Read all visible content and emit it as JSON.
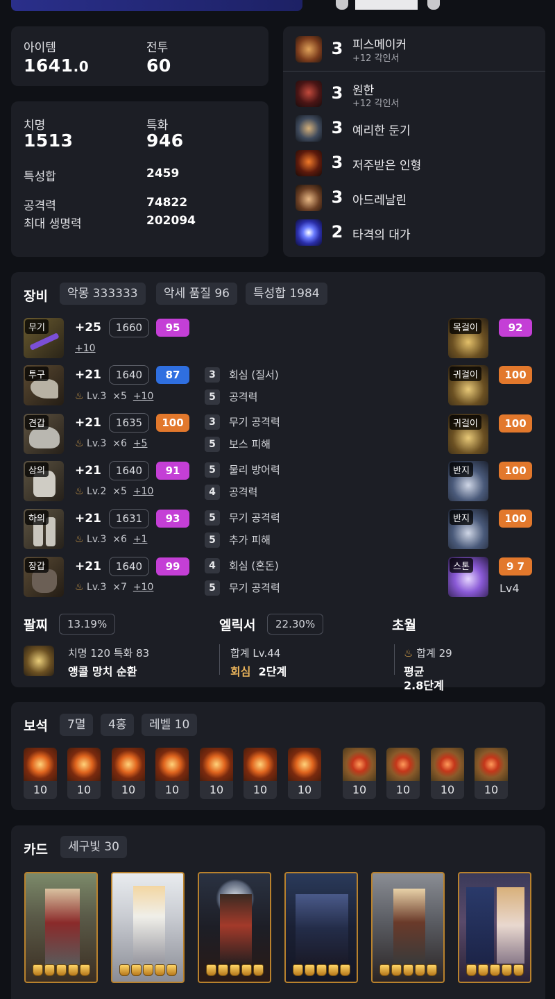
{
  "profile": {
    "item_label": "아이템",
    "item_value_main": "1641",
    "item_value_dec": ".0",
    "combat_label": "전투",
    "combat_value": "60"
  },
  "stats": {
    "crit_label": "치명",
    "crit_value": "1513",
    "spec_label": "특화",
    "spec_value": "946",
    "total_label": "특성합",
    "total_value": "2459",
    "atk_label": "공격력",
    "atk_value": "74822",
    "hp_label": "최대 생명력",
    "hp_value": "202094"
  },
  "engravings": [
    {
      "level": "3",
      "name": "피스메이커",
      "sub": "+12 각인서",
      "icon": "peacemaker-icon"
    },
    {
      "level": "3",
      "name": "원한",
      "sub": "+12 각인서",
      "icon": "grudge-icon"
    },
    {
      "level": "3",
      "name": "예리한 둔기",
      "sub": "",
      "icon": "keen-blunt-icon"
    },
    {
      "level": "3",
      "name": "저주받은 인형",
      "sub": "",
      "icon": "cursed-doll-icon"
    },
    {
      "level": "3",
      "name": "아드레날린",
      "sub": "",
      "icon": "adrenaline-icon"
    },
    {
      "level": "2",
      "name": "타격의 대가",
      "sub": "",
      "icon": "hit-master-icon"
    }
  ],
  "equipment": {
    "title": "장비",
    "chips": [
      "악몽 333333",
      "악세 품질 96",
      "특성합 1984"
    ],
    "flame_icon": "flame-icon",
    "left": [
      {
        "tag": "무기",
        "plus": "+25",
        "ilvl": "1660",
        "quality": "95",
        "qcolor": "purple",
        "lv": "",
        "x": "",
        "adv": "+10",
        "opts": []
      },
      {
        "tag": "투구",
        "plus": "+21",
        "ilvl": "1640",
        "quality": "87",
        "qcolor": "blue",
        "lv": "Lv.3",
        "x": "×5",
        "adv": "+10",
        "opts": [
          {
            "n": "3",
            "t": "회심 (질서)"
          },
          {
            "n": "5",
            "t": "공격력"
          }
        ]
      },
      {
        "tag": "견갑",
        "plus": "+21",
        "ilvl": "1635",
        "quality": "100",
        "qcolor": "orange",
        "lv": "Lv.3",
        "x": "×6",
        "adv": "+5",
        "opts": [
          {
            "n": "3",
            "t": "무기 공격력"
          },
          {
            "n": "5",
            "t": "보스 피해"
          }
        ]
      },
      {
        "tag": "상의",
        "plus": "+21",
        "ilvl": "1640",
        "quality": "91",
        "qcolor": "purple",
        "lv": "Lv.2",
        "x": "×5",
        "adv": "+10",
        "opts": [
          {
            "n": "5",
            "t": "물리 방어력"
          },
          {
            "n": "4",
            "t": "공격력"
          }
        ]
      },
      {
        "tag": "하의",
        "plus": "+21",
        "ilvl": "1631",
        "quality": "93",
        "qcolor": "purple",
        "lv": "Lv.3",
        "x": "×6",
        "adv": "+1",
        "opts": [
          {
            "n": "5",
            "t": "무기 공격력"
          },
          {
            "n": "5",
            "t": "추가 피해"
          }
        ]
      },
      {
        "tag": "장갑",
        "plus": "+21",
        "ilvl": "1640",
        "quality": "99",
        "qcolor": "purple",
        "lv": "Lv.3",
        "x": "×7",
        "adv": "+10",
        "opts": [
          {
            "n": "4",
            "t": "회심 (혼돈)"
          },
          {
            "n": "5",
            "t": "무기 공격력"
          }
        ]
      }
    ],
    "right": [
      {
        "tag": "목걸이",
        "quality": "92",
        "qcolor": "purple"
      },
      {
        "tag": "귀걸이",
        "quality": "100",
        "qcolor": "orange"
      },
      {
        "tag": "귀걸이",
        "quality": "100",
        "qcolor": "orange"
      },
      {
        "tag": "반지",
        "quality": "100",
        "qcolor": "orange"
      },
      {
        "tag": "반지",
        "quality": "100",
        "qcolor": "orange"
      },
      {
        "tag": "스톤",
        "quality": "9 7",
        "qcolor": "orange",
        "extra": "Lv4"
      }
    ]
  },
  "bracelet": {
    "title": "팔찌",
    "chip": "13.19%",
    "line1": "치명 120  특화 83",
    "line2": "앵콜  망치  순환"
  },
  "elixir": {
    "title": "엘릭서",
    "chip": "22.30%",
    "line1": "합계 Lv.44",
    "line2_accent": "회심",
    "line2_rest": "2단계"
  },
  "transcend": {
    "title": "초월",
    "line1": "합계 29",
    "line2": "평균",
    "line3": "2.8단계"
  },
  "gems": {
    "title": "보석",
    "chips": [
      "7멸",
      "4홍",
      "레벨 10"
    ],
    "items": [
      "10",
      "10",
      "10",
      "10",
      "10",
      "10",
      "10",
      "10",
      "10",
      "10",
      "10"
    ]
  },
  "cards": {
    "title": "카드",
    "chip": "세구빛 30",
    "items": [
      {
        "name": "card-1",
        "awaken": 5
      },
      {
        "name": "card-2",
        "awaken": 5
      },
      {
        "name": "card-3",
        "awaken": 5
      },
      {
        "name": "card-4",
        "awaken": 5
      },
      {
        "name": "card-5",
        "awaken": 5
      },
      {
        "name": "card-6",
        "awaken": 5
      }
    ]
  },
  "colors": {
    "purple": "#c43fd6",
    "blue": "#2f6fe0",
    "orange": "#e2782c",
    "gold": "#d8a24a"
  }
}
